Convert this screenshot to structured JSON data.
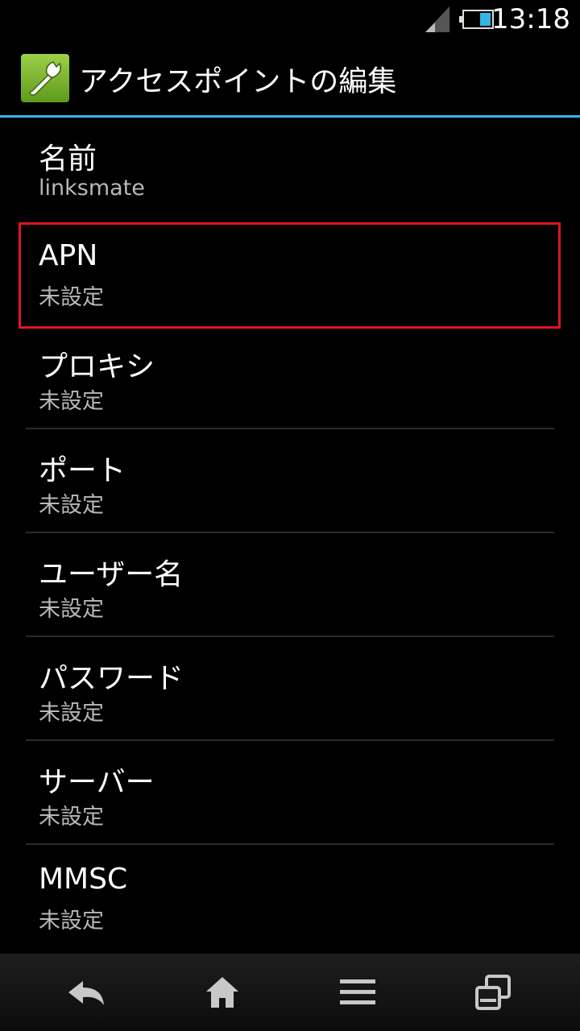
{
  "status_bar": {
    "time": "13:18",
    "signal_icon": "signal-icon",
    "battery_icon": "battery-icon"
  },
  "action_bar": {
    "icon": "wrench-icon",
    "title": "アクセスポイントの編集",
    "accent_color": "#33b5e5"
  },
  "fields": [
    {
      "label": "名前",
      "value": "linksmate"
    },
    {
      "label": "APN",
      "value": "未設定"
    },
    {
      "label": "プロキシ",
      "value": "未設定"
    },
    {
      "label": "ポート",
      "value": "未設定"
    },
    {
      "label": "ユーザー名",
      "value": "未設定"
    },
    {
      "label": "パスワード",
      "value": "未設定"
    },
    {
      "label": "サーバー",
      "value": "未設定"
    },
    {
      "label": "MMSC",
      "value": "未設定"
    }
  ],
  "highlight_color": "#e0141c",
  "nav_bar": {
    "buttons": [
      "back-icon",
      "home-icon",
      "menu-icon",
      "recent-apps-icon"
    ]
  }
}
